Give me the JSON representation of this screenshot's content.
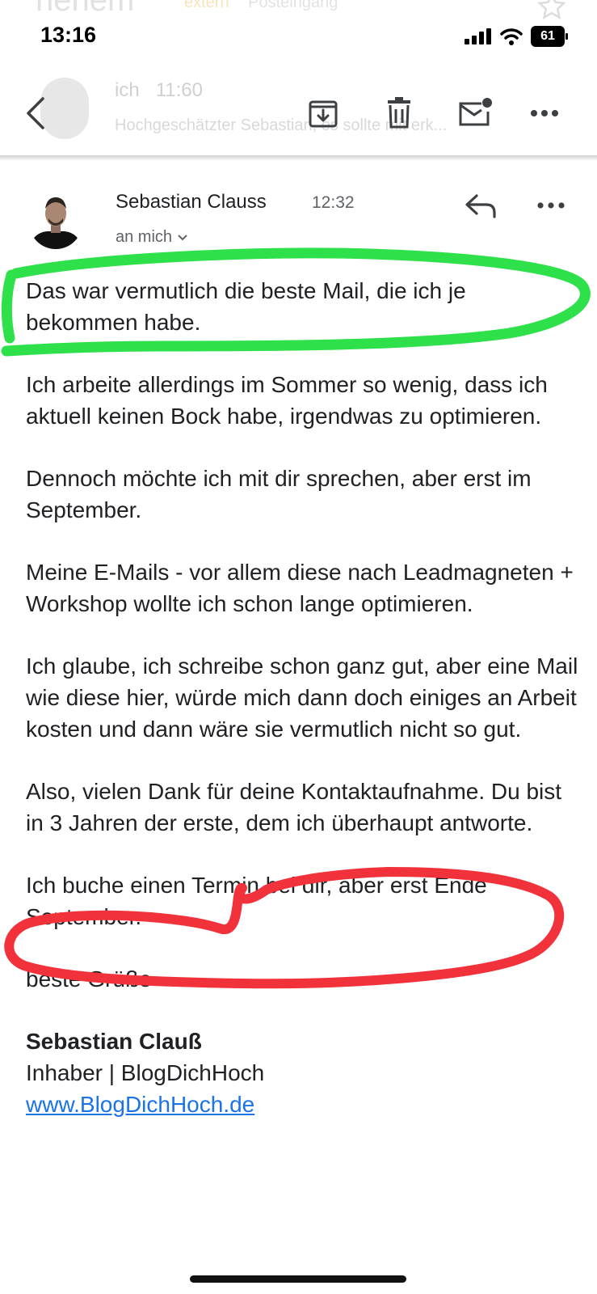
{
  "background_header": {
    "title": "nehem",
    "tags": [
      "extern",
      "Posteingang"
    ],
    "previous_message": {
      "sender": "ich",
      "time": "11:60",
      "preview": "Hochgeschätzter Sebastian, es sollte mit erk..."
    }
  },
  "status_bar": {
    "time": "13:16",
    "battery": "61"
  },
  "toolbar": {
    "back_icon": "chevron-left-icon",
    "archive_icon": "archive-icon",
    "delete_icon": "trash-icon",
    "mark_unread_icon": "mail-unread-icon",
    "more_icon": "more-horizontal-icon"
  },
  "message": {
    "sender": "Sebastian Clauss",
    "time": "12:32",
    "recipient": "an mich",
    "body": [
      "Das war vermutlich die beste Mail, die ich je bekommen habe.",
      "Ich arbeite allerdings im Sommer so wenig, dass ich aktuell keinen Bock habe, irgendwas zu optimieren.",
      "Dennoch möchte ich mit dir sprechen, aber erst im September.",
      "Meine E-Mails - vor allem diese nach Leadmagneten + Workshop wollte ich schon lange optimieren.",
      "Ich glaube, ich schreibe schon ganz gut, aber eine Mail wie diese hier, würde mich dann doch einiges an Arbeit kosten und dann wäre sie vermutlich nicht so gut.",
      "Also, vielen Dank für deine Kontaktaufnahme. Du bist in 3 Jahren der erste, dem ich überhaupt antworte.",
      "Ich buche einen Termin bei dir, aber erst Ende September.",
      "beste Grüße"
    ],
    "signature": {
      "name": "Sebastian Clauß",
      "role": "Inhaber | BlogDichHoch",
      "link": "www.BlogDichHoch.de"
    }
  },
  "colors": {
    "highlight_green": "#2ee04a",
    "highlight_red": "#f2323a",
    "link": "#1a73e8"
  }
}
